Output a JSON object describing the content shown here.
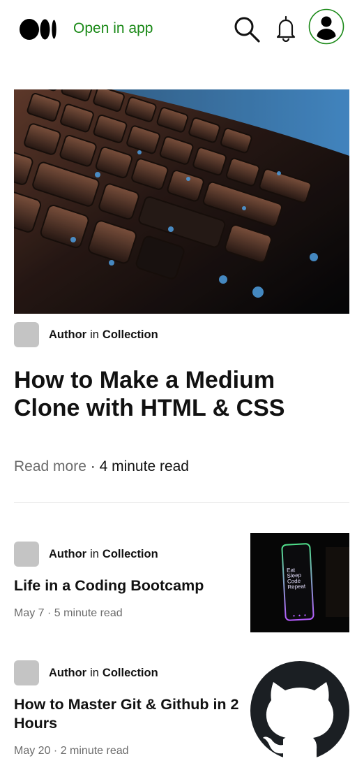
{
  "header": {
    "logo": "medium-logo",
    "open_in_app": "Open in app",
    "icons": [
      "search-icon",
      "bell-icon",
      "user-avatar-icon"
    ],
    "accent_color": "#1a8917"
  },
  "hero": {
    "image": "keyboard-photo",
    "author": "Author",
    "in_word": "in",
    "collection": "Collection",
    "title": "How to Make a Medium Clone with HTML & CSS",
    "read_more": "Read more",
    "separator": "·",
    "read_time": "4 minute read"
  },
  "posts": [
    {
      "author": "Author",
      "in_word": "in",
      "collection": "Collection",
      "title": "Life in a Coding Bootcamp",
      "meta": "May 7 · 5 minute read",
      "thumb_lines": [
        "Eat",
        "Sleep",
        "Code",
        "Repeat"
      ]
    },
    {
      "author": "Author",
      "in_word": "in",
      "collection": "Collection",
      "title": "How to Master Git & Github in 2 Hours",
      "meta": "May 20 · 2 minute read",
      "thumb": "github-logo"
    }
  ]
}
